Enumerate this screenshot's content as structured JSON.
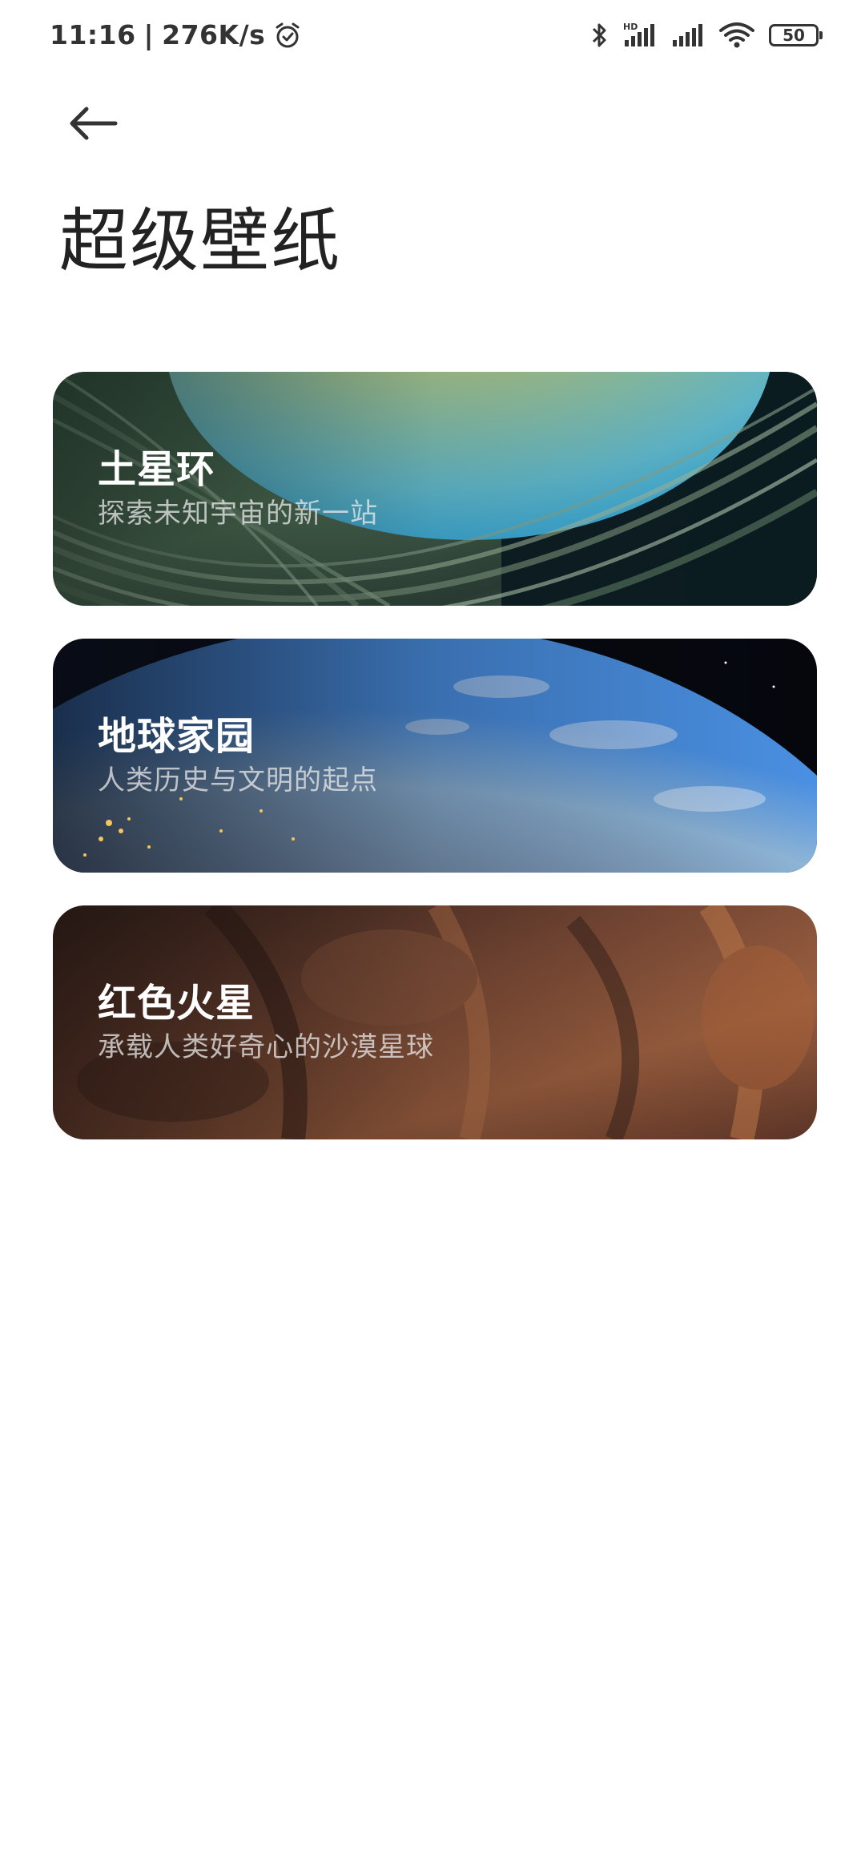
{
  "status_bar": {
    "time": "11:16",
    "separator": "|",
    "speed": "276K/s",
    "alarm_icon": "alarm-icon",
    "bluetooth_icon": "bluetooth-icon",
    "signal_hd_icon": "signal-hd-icon",
    "signal_icon": "signal-icon",
    "wifi_icon": "wifi-icon",
    "battery_level": "50"
  },
  "header": {
    "back_icon": "back-arrow-icon",
    "title": "超级壁纸"
  },
  "wallpapers": [
    {
      "title": "土星环",
      "subtitle": "探索未知宇宙的新一站",
      "theme": "saturn"
    },
    {
      "title": "地球家园",
      "subtitle": "人类历史与文明的起点",
      "theme": "earth"
    },
    {
      "title": "红色火星",
      "subtitle": "承载人类好奇心的沙漠星球",
      "theme": "mars"
    }
  ]
}
